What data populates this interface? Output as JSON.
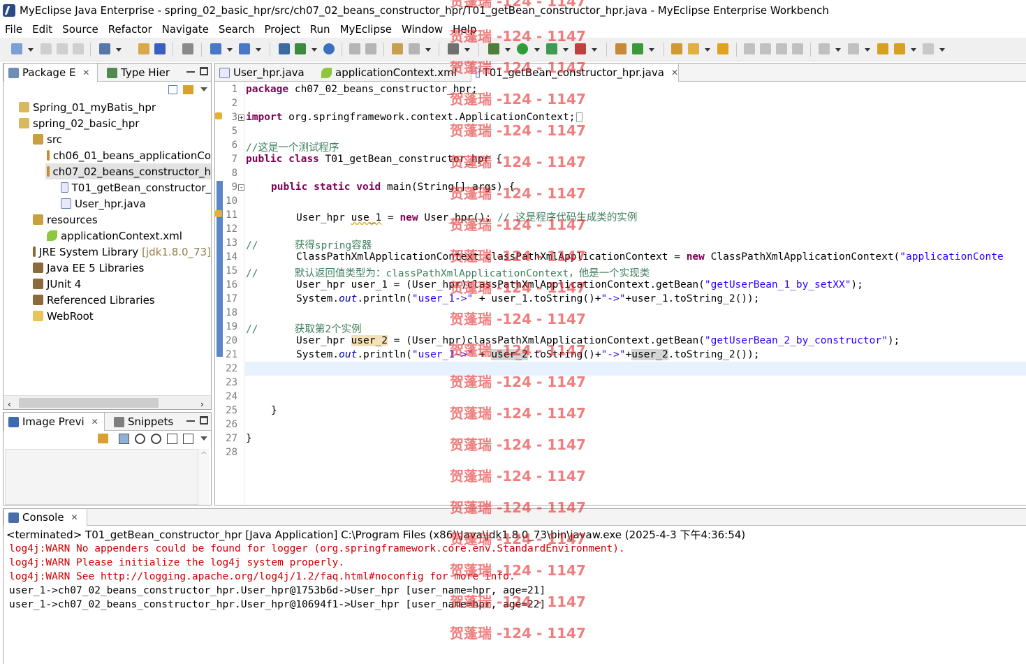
{
  "window": {
    "title": "MyEclipse Java Enterprise - spring_02_basic_hpr/src/ch07_02_beans_constructor_hpr/T01_getBean_constructor_hpr.java - MyEclipse Enterprise Workbench"
  },
  "menu": [
    "File",
    "Edit",
    "Source",
    "Refactor",
    "Navigate",
    "Search",
    "Project",
    "Run",
    "MyEclipse",
    "Window",
    "Help"
  ],
  "package_explorer": {
    "tabs": [
      {
        "label": "Package E",
        "icon": "package-explorer-icon"
      },
      {
        "label": "Type Hier",
        "icon": "type-hierarchy-icon"
      }
    ],
    "tree": [
      {
        "label": "Spring_01_myBatis_hpr",
        "icon": "project-icon",
        "extra": ""
      },
      {
        "label": "spring_02_basic_hpr",
        "icon": "project-icon",
        "extra": ""
      },
      {
        "label": "src",
        "icon": "source-folder-icon",
        "extra": ""
      },
      {
        "label": "ch06_01_beans_applicationCo",
        "icon": "package-icon",
        "extra": ""
      },
      {
        "label": "ch07_02_beans_constructor_h",
        "icon": "package-icon",
        "extra": ""
      },
      {
        "label": "T01_getBean_constructor_",
        "icon": "java-file-icon",
        "extra": ""
      },
      {
        "label": "User_hpr.java",
        "icon": "java-file-icon",
        "extra": ""
      },
      {
        "label": "resources",
        "icon": "source-folder-icon",
        "extra": ""
      },
      {
        "label": "applicationContext.xml",
        "icon": "spring-xml-icon",
        "extra": ""
      },
      {
        "label": "JRE System Library",
        "icon": "library-icon",
        "extra": "[jdk1.8.0_73]"
      },
      {
        "label": "Java EE 5 Libraries",
        "icon": "library-icon",
        "extra": ""
      },
      {
        "label": "JUnit 4",
        "icon": "library-icon",
        "extra": ""
      },
      {
        "label": "Referenced Libraries",
        "icon": "library-icon",
        "extra": ""
      },
      {
        "label": "WebRoot",
        "icon": "folder-icon",
        "extra": ""
      }
    ]
  },
  "image_preview": {
    "tabs": [
      {
        "label": "Image Previ",
        "icon": "image-preview-icon"
      },
      {
        "label": "Snippets",
        "icon": "snippets-icon"
      }
    ]
  },
  "editor": {
    "tabs": [
      {
        "label": "User_hpr.java",
        "icon": "java-file-icon"
      },
      {
        "label": "applicationContext.xml",
        "icon": "spring-xml-icon"
      },
      {
        "label": "T01_getBean_constructor_hpr.java",
        "icon": "java-file-icon"
      }
    ],
    "line_numbers": [
      "1",
      "2",
      "3",
      "5",
      "6",
      "7",
      "8",
      "9",
      "10",
      "11",
      "12",
      "13",
      "14",
      "15",
      "16",
      "17",
      "18",
      "19",
      "20",
      "21",
      "22",
      "23",
      "24",
      "25",
      "26",
      "27",
      "28"
    ],
    "lines": {
      "l1a": "package",
      "l1b": " ch07_02_beans_constructor_hpr;",
      "l3a": "import",
      "l3b": " org.springframework.context.ApplicationContext;",
      "l6": "//这是一个测试程序",
      "l7a": "public",
      "l7b": "class",
      "l7c": " T01_getBean_constructor_hpr {",
      "l9a": "public",
      "l9b": "static",
      "l9c": "void",
      "l9d": " main(String[] args) {",
      "l11a": "User_hpr ",
      "l11b": "use_1",
      "l11c": " = ",
      "l11d": "new",
      "l11e": " User_hpr(); ",
      "l11f": "// 这是程序代码生成类的实例",
      "l13": "//      获得spring容器",
      "l14a": "ClassPathXmlApplicationContext classPathXmlApplicationContext = ",
      "l14b": "new",
      "l14c": " ClassPathXmlApplicationContext(",
      "l14d": "\"applicationConte",
      "l15": "//      默认返回值类型为：classPathXmlApplicationContext，他是一个实现类",
      "l16a": "User_hpr user_1 = (User_hpr)classPathXmlApplicationContext.getBean(",
      "l16b": "\"getUserBean_1_by_setXX\"",
      "l16c": ");",
      "l17a": "System.",
      "l17b": "out",
      "l17c": ".println(",
      "l17d": "\"user_1->\"",
      "l17e": " + user_1.toString()+",
      "l17f": "\"->\"",
      "l17g": "+user_1.toString_2());",
      "l19": "//      获取第2个实例",
      "l20a": "User_hpr ",
      "l20b": "user_2",
      "l20c": " = (User_hpr)classPathXmlApplicationContext.getBean(",
      "l20d": "\"getUserBean_2_by_constructor\"",
      "l20e": ");",
      "l21a": "System.",
      "l21b": "out",
      "l21c": ".println(",
      "l21d": "\"user_1->\"",
      "l21e": " + ",
      "l21f": "user_2",
      "l21g": ".toString()+",
      "l21h": "\"->\"",
      "l21i": "+",
      "l21j": "user_2",
      "l21k": ".toString_2());",
      "l25": "}",
      "l27": "}"
    }
  },
  "console": {
    "tab_label": "Console",
    "header": "<terminated> T01_getBean_constructor_hpr [Java Application] C:\\Program Files (x86)\\Java\\jdk1.8.0_73\\bin\\javaw.exe (2025-4-3 下午4:36:54)",
    "lines": [
      {
        "text": "log4j:WARN No appenders could be found for logger (org.springframework.core.env.StandardEnvironment).",
        "type": "error"
      },
      {
        "text": "log4j:WARN Please initialize the log4j system properly.",
        "type": "error"
      },
      {
        "text": "log4j:WARN See http://logging.apache.org/log4j/1.2/faq.html#noconfig for more info.",
        "type": "error"
      },
      {
        "text": "user_1->ch07_02_beans_constructor_hpr.User_hpr@1753b6d->User_hpr [user_name=hpr, age=21]",
        "type": "out"
      },
      {
        "text": "user_1->ch07_02_beans_constructor_hpr.User_hpr@10694f1->User_hpr [user_name=hpr, age=22]",
        "type": "out"
      }
    ]
  },
  "watermark": {
    "text": "贺蓬瑞 -124 - 1147",
    "color": "#e62828"
  }
}
